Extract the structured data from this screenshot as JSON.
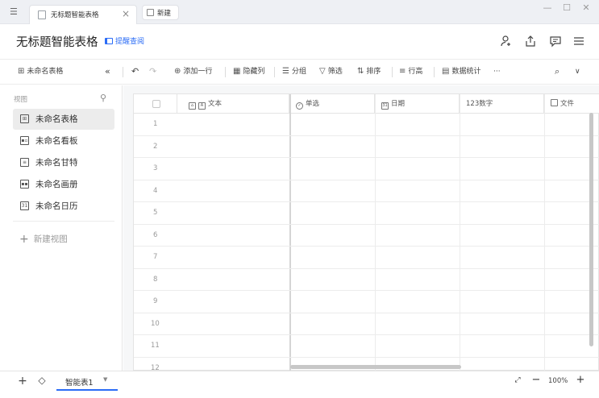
{
  "tabs": {
    "active_label": "无标题智能表格",
    "new_label": "新建"
  },
  "doc": {
    "title": "无标题智能表格",
    "remind_label": "提醒查阅"
  },
  "toolbar": {
    "table_select": "未命名表格",
    "add_row": "添加一行",
    "hide_columns": "隐藏列",
    "group": "分组",
    "filter": "筛选",
    "sort": "排序",
    "row_height": "行高",
    "statistics": "数据统计",
    "more": "···"
  },
  "sidebar": {
    "section_label": "视图",
    "views": [
      {
        "label": "未命名表格",
        "icon": "grid-icon",
        "active": true
      },
      {
        "label": "未命名看板",
        "icon": "kanban-icon",
        "active": false
      },
      {
        "label": "未命名甘特",
        "icon": "gantt-icon",
        "active": false
      },
      {
        "label": "未命名画册",
        "icon": "gallery-icon",
        "active": false
      },
      {
        "label": "未命名日历",
        "icon": "calendar-icon",
        "active": false
      }
    ],
    "new_view": "新建视图"
  },
  "grid": {
    "columns": [
      {
        "label": "文本",
        "type": "text"
      },
      {
        "label": "单选",
        "type": "single-select"
      },
      {
        "label": "日期",
        "type": "date"
      },
      {
        "label": "数字",
        "type": "number",
        "prefix": "123"
      },
      {
        "label": "文件",
        "type": "file"
      }
    ],
    "row_numbers": [
      "1",
      "2",
      "3",
      "4",
      "5",
      "6",
      "7",
      "8",
      "9",
      "10",
      "11",
      "12"
    ]
  },
  "bottom": {
    "sheet_name": "智能表1",
    "zoom": "100%"
  },
  "colors": {
    "accent": "#2b6cf6",
    "tabbar_bg": "#eef0f4",
    "active_view_bg": "#ececec"
  }
}
